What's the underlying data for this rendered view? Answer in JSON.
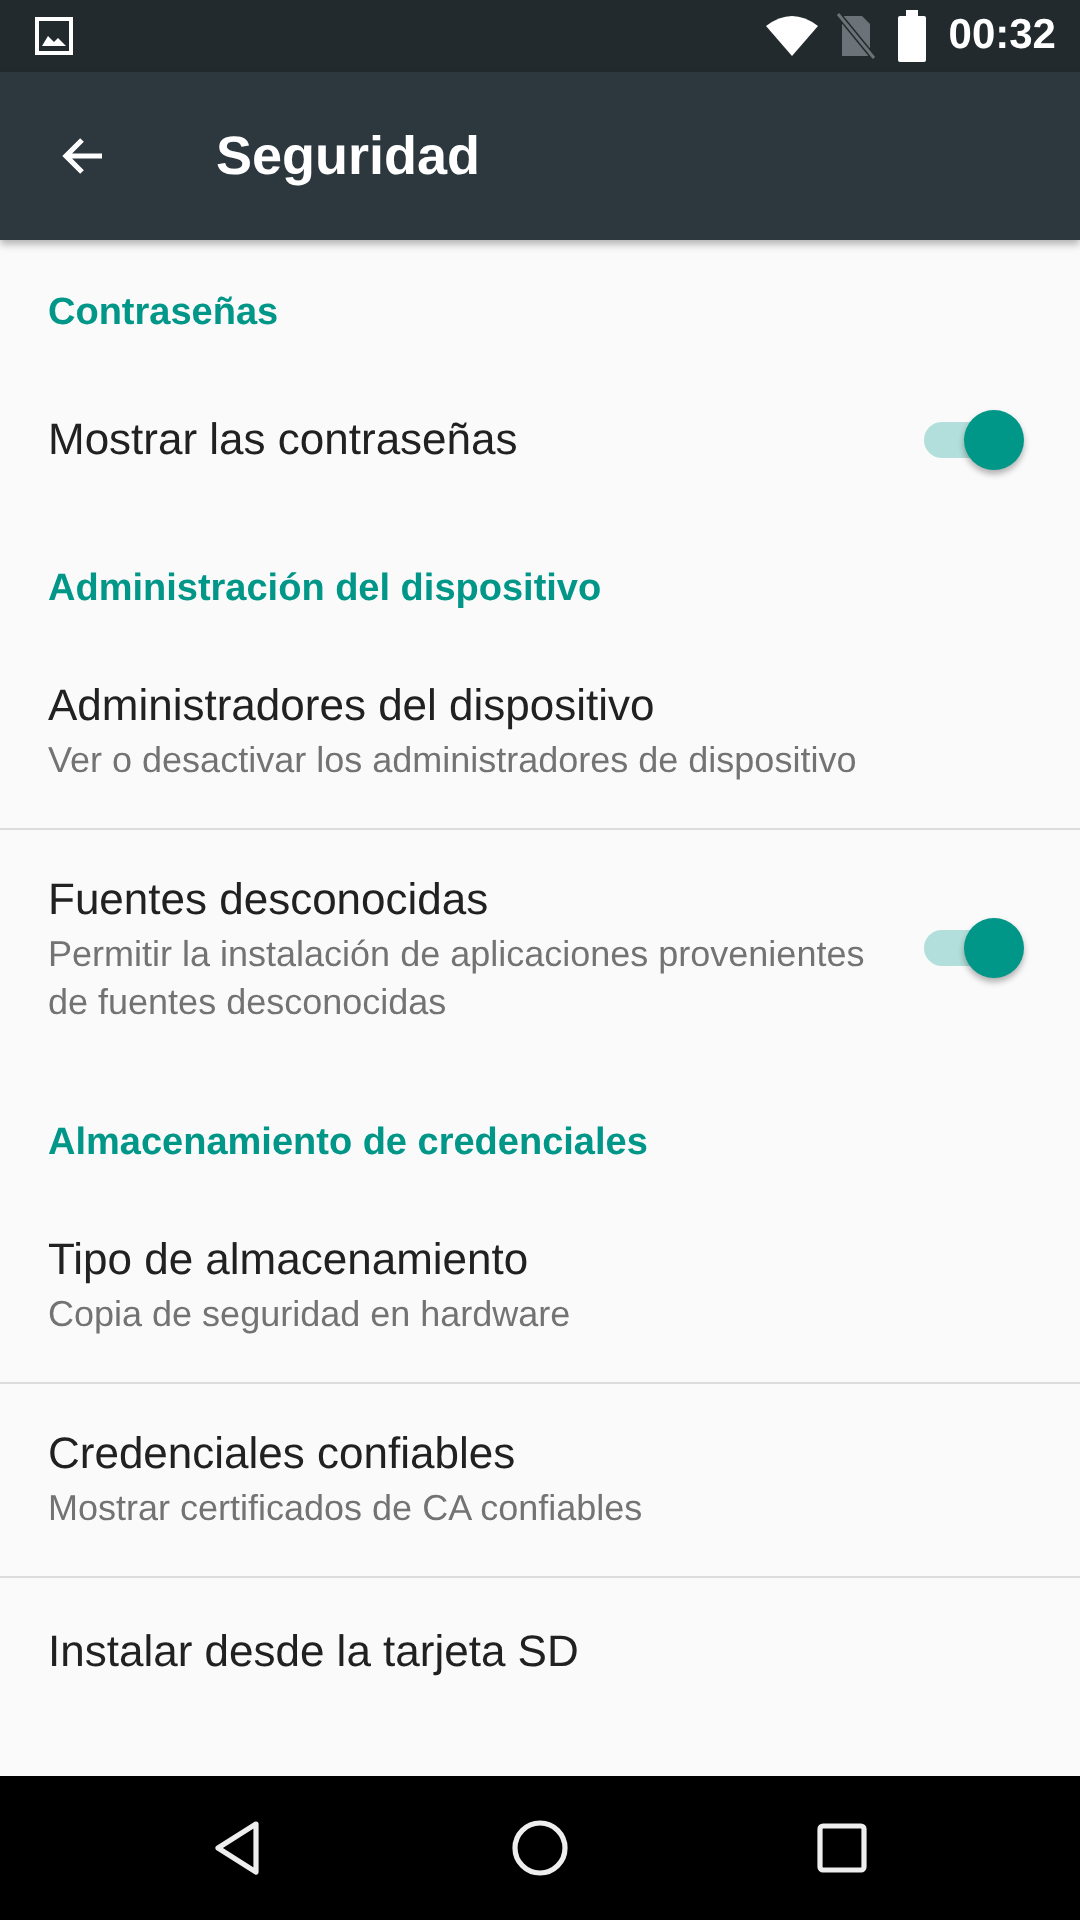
{
  "status_bar": {
    "time": "00:32"
  },
  "app_bar": {
    "title": "Seguridad"
  },
  "categories": [
    {
      "title": "Contraseñas",
      "items": [
        {
          "kind": "switch",
          "title": "Mostrar las contraseñas",
          "on": true
        }
      ]
    },
    {
      "title": "Administración del dispositivo",
      "items": [
        {
          "kind": "plain",
          "title": "Administradores del dispositivo",
          "summary": "Ver o desactivar los administradores de dispositivo"
        },
        {
          "kind": "switch",
          "title": "Fuentes desconocidas",
          "summary": "Permitir la instalación de aplicaciones provenientes de fuentes desconocidas",
          "on": true
        }
      ]
    },
    {
      "title": "Almacenamiento de credenciales",
      "items": [
        {
          "kind": "plain",
          "title": "Tipo de almacenamiento",
          "summary": "Copia de seguridad en hardware"
        },
        {
          "kind": "plain",
          "title": "Credenciales confiables",
          "summary": "Mostrar certificados de CA confiables"
        },
        {
          "kind": "plain",
          "title": "Instalar desde la tarjeta SD"
        }
      ]
    }
  ]
}
